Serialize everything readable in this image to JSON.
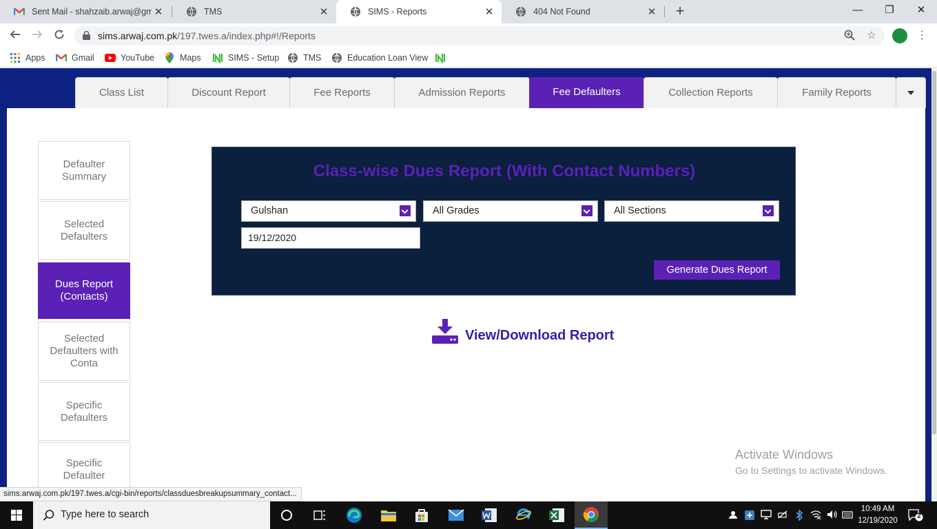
{
  "browser": {
    "tabs": [
      {
        "title": "Sent Mail - shahzaib.arwaj@gmail",
        "favicon": "gmail-icon"
      },
      {
        "title": "TMS",
        "favicon": "globe-icon"
      },
      {
        "title": "SIMS - Reports",
        "favicon": "globe-icon",
        "active": true
      },
      {
        "title": "404 Not Found",
        "favicon": "globe-icon"
      }
    ],
    "url_host": "sims.arwaj.com.pk",
    "url_path": "/197.twes.a/index.php#!/Reports",
    "bookmarks": [
      "Apps",
      "Gmail",
      "YouTube",
      "Maps",
      "SIMS - Setup",
      "TMS",
      "Education Loan View"
    ]
  },
  "app": {
    "nav_tabs": [
      "Class List",
      "Discount Report",
      "Fee Reports",
      "Admission Reports",
      "Fee Defaulters",
      "Collection Reports",
      "Family Reports"
    ],
    "active_nav_tab": "Fee Defaulters",
    "sidebar": [
      {
        "label": "Defaulter Summary"
      },
      {
        "label": "Selected Defaulters"
      },
      {
        "label": "Dues Report (Contacts)",
        "active": true
      },
      {
        "label": "Selected Defaulters with Conta"
      },
      {
        "label": "Specific Defaulters"
      },
      {
        "label": "Specific Defaulter"
      }
    ],
    "report": {
      "title": "Class-wise Dues Report (With Contact Numbers)",
      "campus": "Gulshan",
      "grade": "All Grades",
      "section": "All Sections",
      "date": "19/12/2020",
      "generate_label": "Generate Dues Report"
    },
    "download_label": "View/Download Report",
    "accent_color": "#5b21b6",
    "panel_color": "#0b1f3f"
  },
  "watermark": {
    "line1": "Activate Windows",
    "line2": "Go to Settings to activate Windows."
  },
  "status_url": "sims.arwaj.com.pk/197.twes.a/cgi-bin/reports/classduesbreakupsummary_contact...",
  "taskbar": {
    "search_placeholder": "Type here to search",
    "time": "10:49 AM",
    "date": "12/19/2020",
    "notifications": "2"
  }
}
